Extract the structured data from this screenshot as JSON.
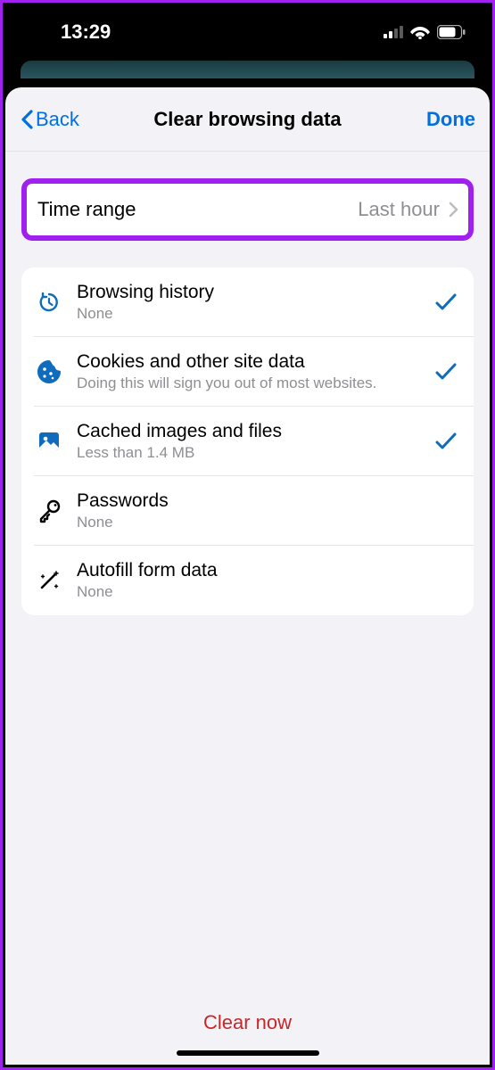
{
  "status": {
    "time": "13:29"
  },
  "nav": {
    "back_label": "Back",
    "title": "Clear browsing data",
    "done_label": "Done"
  },
  "time_range": {
    "label": "Time range",
    "value": "Last hour"
  },
  "items": [
    {
      "title": "Browsing history",
      "subtitle": "None",
      "icon": "history-icon",
      "checked": true,
      "color": "#0f6cbd"
    },
    {
      "title": "Cookies and other site data",
      "subtitle": "Doing this will sign you out of most websites.",
      "icon": "cookie-icon",
      "checked": true,
      "color": "#0f6cbd"
    },
    {
      "title": "Cached images and files",
      "subtitle": "Less than 1.4 MB",
      "icon": "image-icon",
      "checked": true,
      "color": "#0f6cbd"
    },
    {
      "title": "Passwords",
      "subtitle": "None",
      "icon": "key-icon",
      "checked": false,
      "color": "#000"
    },
    {
      "title": "Autofill form data",
      "subtitle": "None",
      "icon": "wand-icon",
      "checked": false,
      "color": "#000"
    }
  ],
  "footer": {
    "clear_label": "Clear now"
  }
}
